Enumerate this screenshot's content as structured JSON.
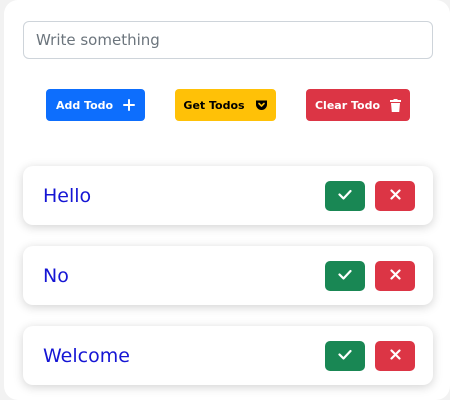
{
  "input": {
    "placeholder": "Write something",
    "value": ""
  },
  "buttons": {
    "add_label": "Add Todo",
    "get_label": "Get Todos",
    "clear_label": "Clear Todo"
  },
  "todos": [
    {
      "title": "Hello"
    },
    {
      "title": "No"
    },
    {
      "title": "Welcome"
    }
  ],
  "icons": {
    "add": "plus-icon",
    "get": "pocket-icon",
    "clear": "trash-icon",
    "complete": "check-icon",
    "delete": "x-icon"
  },
  "colors": {
    "primary": "#0d6efd",
    "warning": "#ffc107",
    "danger": "#dc3545",
    "success": "#198754",
    "todo_text": "#1515d4"
  }
}
